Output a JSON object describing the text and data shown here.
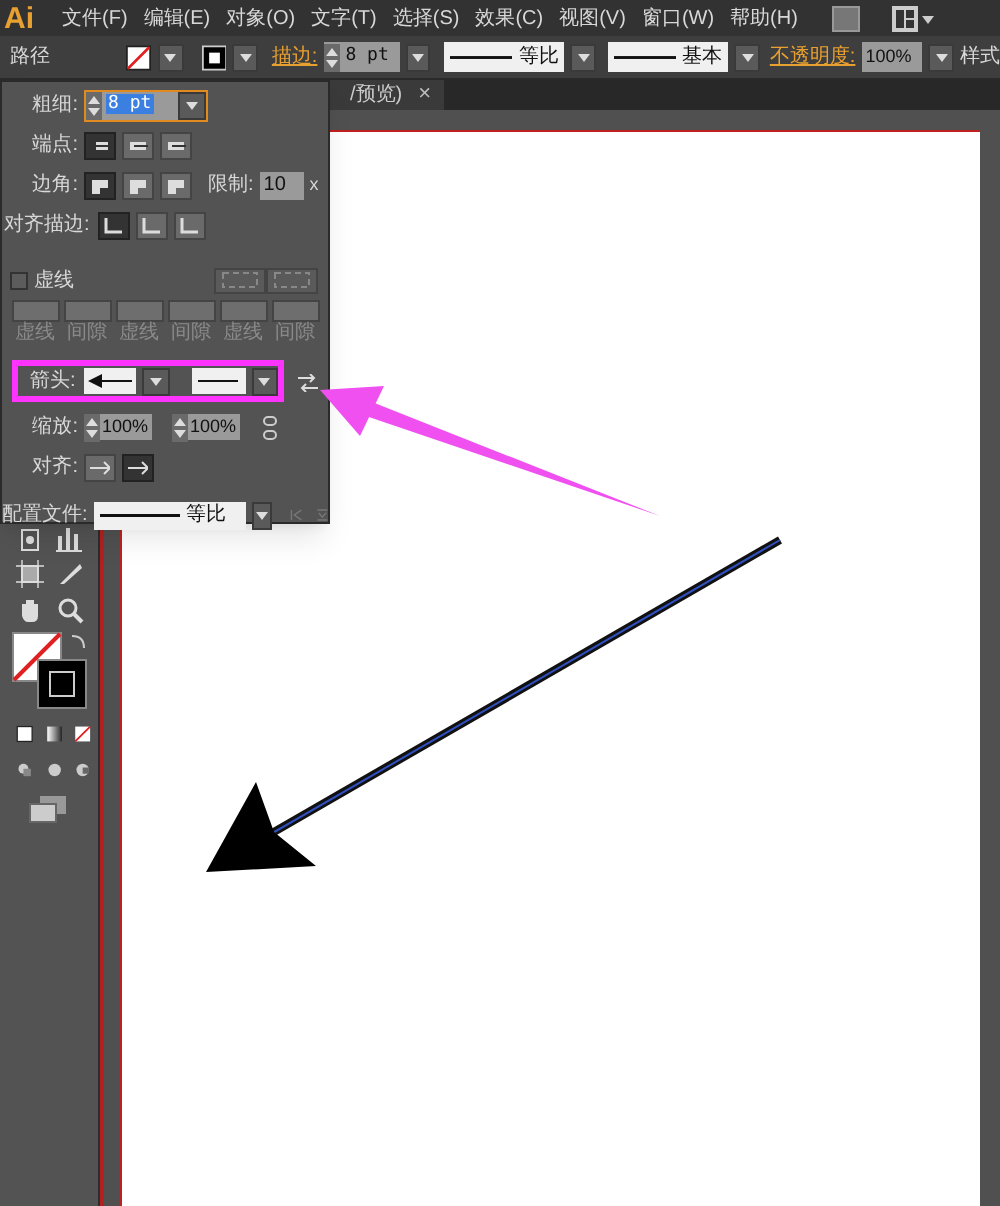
{
  "menu_bar": {
    "logo": "Ai",
    "items": [
      "文件(F)",
      "编辑(E)",
      "对象(O)",
      "文字(T)",
      "选择(S)",
      "效果(C)",
      "视图(V)",
      "窗口(W)",
      "帮助(H)"
    ]
  },
  "control_bar": {
    "object_label": "路径",
    "stroke_label": "描边:",
    "stroke_weight": "8 pt",
    "profile": "等比",
    "brush": "基本",
    "opacity_label": "不透明度:",
    "opacity": "100%",
    "style_label": "样式"
  },
  "document_tab": {
    "title": "/预览)",
    "close": "×"
  },
  "stroke_panel": {
    "weight_label": "粗细:",
    "weight": "8 pt",
    "cap_label": "端点:",
    "caps": [
      {
        "selected": true
      },
      {
        "selected": false
      },
      {
        "selected": false
      }
    ],
    "corner_label": "边角:",
    "corners": [
      {
        "selected": true
      },
      {
        "selected": false
      },
      {
        "selected": false
      }
    ],
    "limit_label": "限制:",
    "limit": "10",
    "limit_unit": "x",
    "align_label": "对齐描边:",
    "aligns": [
      {
        "selected": true
      },
      {
        "selected": false
      },
      {
        "selected": false
      }
    ],
    "dashed": {
      "label": "虚线",
      "checked": false
    },
    "dash_fields": [
      "虚线",
      "间隙",
      "虚线",
      "间隙",
      "虚线",
      "间隙"
    ],
    "arrow_label": "箭头:",
    "scale_label": "缩放:",
    "scale_start": "100%",
    "scale_end": "100%",
    "arrow_align_label": "对齐:",
    "arrow_aligns": [
      {
        "selected": false
      },
      {
        "selected": true
      }
    ],
    "profile_label": "配置文件:",
    "profile": "等比"
  }
}
